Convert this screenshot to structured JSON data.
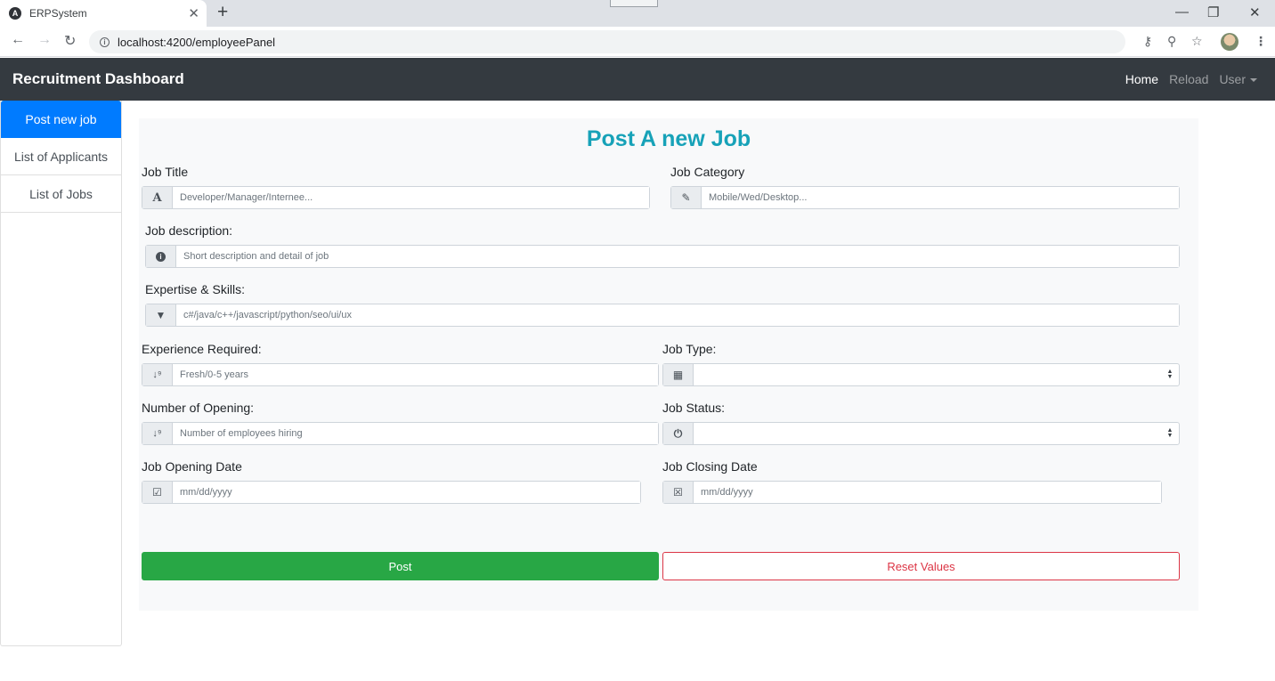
{
  "browser": {
    "tab_title": "ERPSystem",
    "tab_favicon": "A",
    "url": "localhost:4200/employeePanel",
    "icons": [
      "angular-favicon",
      "close-icon",
      "plus-icon",
      "back-arrow-icon",
      "forward-arrow-icon",
      "reload-icon",
      "info-icon",
      "key-icon",
      "zoom-icon",
      "star-icon",
      "avatar",
      "more-vert-icon",
      "minimize-icon",
      "maximize-icon",
      "close-window-icon"
    ]
  },
  "navbar": {
    "brand": "Recruitment Dashboard",
    "home": "Home",
    "reload": "Reload",
    "user": "User"
  },
  "sidebar": {
    "items": [
      {
        "label": "Post new job",
        "active": true
      },
      {
        "label": "List of Applicants",
        "active": false
      },
      {
        "label": "List of Jobs",
        "active": false
      }
    ]
  },
  "form": {
    "title": "Post A new Job",
    "job_title": {
      "label": "Job Title",
      "placeholder": "Developer/Manager/Internee...",
      "icon": "font-icon"
    },
    "job_category": {
      "label": "Job Category",
      "placeholder": "Mobile/Wed/Desktop...",
      "icon": "edit-icon"
    },
    "job_description": {
      "label": "Job description:",
      "placeholder": "Short description and detail of job",
      "icon": "info-circle-icon"
    },
    "expertise": {
      "label": "Expertise & Skills:",
      "placeholder": "c#/java/c++/javascript/python/seo/ui/ux",
      "icon": "filter-icon"
    },
    "experience": {
      "label": "Experience Required:",
      "placeholder": "Fresh/0-5 years",
      "icon": "sort-numeric-icon"
    },
    "job_type": {
      "label": "Job Type:",
      "value": "",
      "icon": "calendar-icon"
    },
    "openings": {
      "label": "Number of Opening:",
      "placeholder": "Number of employees hiring",
      "icon": "sort-numeric-icon"
    },
    "job_status": {
      "label": "Job Status:",
      "value": "",
      "icon": "power-icon"
    },
    "opening_date": {
      "label": "Job Opening Date",
      "placeholder": "mm/dd/yyyy",
      "icon": "calendar-check-icon"
    },
    "closing_date": {
      "label": "Job Closing Date",
      "placeholder": "mm/dd/yyyy",
      "icon": "calendar-x-icon"
    },
    "post_button": "Post",
    "reset_button": "Reset Values"
  },
  "colors": {
    "navbar_bg": "#343a40",
    "sidebar_active": "#007bff",
    "title": "#17a2b8",
    "post_button": "#28a745",
    "reset_button": "#dc3545"
  }
}
